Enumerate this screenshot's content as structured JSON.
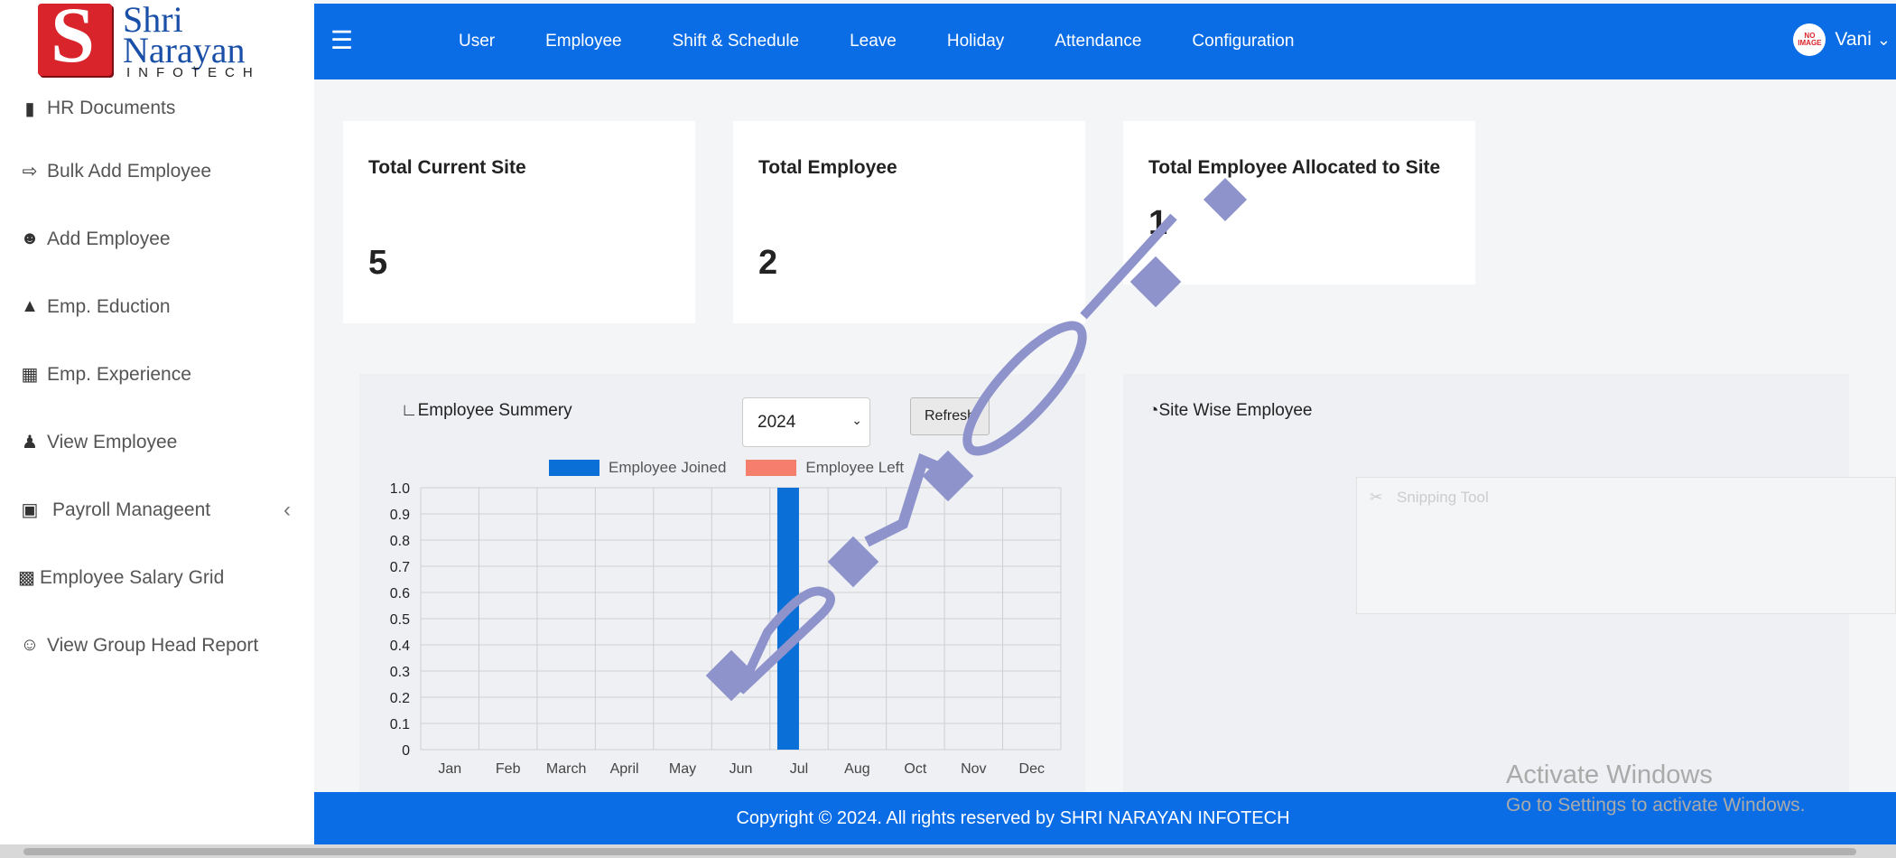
{
  "brand": {
    "line1": "Shri",
    "line2": "Narayan",
    "line3": "INFOTECH",
    "mark": "S"
  },
  "sidebar": {
    "items": [
      {
        "label": "HR Documents",
        "icon": "book-icon"
      },
      {
        "label": "Bulk Add Employee",
        "icon": "import-icon"
      },
      {
        "label": "Add Employee",
        "icon": "users-gear-icon"
      },
      {
        "label": "Emp. Eduction",
        "icon": "graduation-cap-icon"
      },
      {
        "label": "Emp. Experience",
        "icon": "keyboard-icon"
      },
      {
        "label": "View Employee",
        "icon": "person-icon"
      },
      {
        "label": "Payroll Manageent",
        "icon": "money-icon"
      },
      {
        "label": "Employee Salary Grid",
        "icon": "file-icon"
      },
      {
        "label": "View Group Head Report",
        "icon": "users-icon"
      }
    ]
  },
  "topbar": {
    "menu": [
      "User",
      "Employee",
      "Shift & Schedule",
      "Leave",
      "Holiday",
      "Attendance",
      "Configuration"
    ],
    "user_name": "Vani",
    "avatar_text_1": "NO",
    "avatar_text_2": "IMAGE"
  },
  "cards": [
    {
      "title": "Total Current Site",
      "value": "5"
    },
    {
      "title": "Total Employee",
      "value": "2"
    },
    {
      "title": "Total Employee Allocated to Site",
      "value": "1"
    }
  ],
  "summary": {
    "title": "Employee Summery",
    "year": "2024",
    "refresh_label": "Refresh"
  },
  "site_wise": {
    "title": "Site Wise Employee"
  },
  "chart_data": {
    "type": "bar",
    "categories": [
      "Jan",
      "Feb",
      "March",
      "April",
      "May",
      "Jun",
      "Jul",
      "Aug",
      "Oct",
      "Nov",
      "Dec"
    ],
    "series": [
      {
        "name": "Employee Joined",
        "color": "#0a6fd6",
        "values": [
          0,
          0,
          0,
          0,
          0,
          0,
          1,
          0,
          0,
          0,
          0
        ]
      },
      {
        "name": "Employee Left",
        "color": "#f57f6c",
        "values": [
          0,
          0,
          0,
          0,
          0,
          0,
          0,
          0,
          0,
          0,
          0
        ]
      }
    ],
    "yticks": [
      "1.0",
      "0.9",
      "0.8",
      "0.7",
      "0.6",
      "0.5",
      "0.4",
      "0.3",
      "0.2",
      "0.1",
      "0"
    ],
    "ylim": [
      0,
      1
    ],
    "grid": true,
    "legend": "top"
  },
  "footer": {
    "text": "Copyright © 2024. All rights reserved by SHRI NARAYAN INFOTECH"
  },
  "overlay": {
    "activate_1": "Activate Windows",
    "activate_2": "Go to Settings to activate Windows.",
    "snipping": "Snipping Tool"
  },
  "colors": {
    "primary": "#0a6de6",
    "brand_red": "#d9242b",
    "brand_blue": "#1a4fa8"
  }
}
